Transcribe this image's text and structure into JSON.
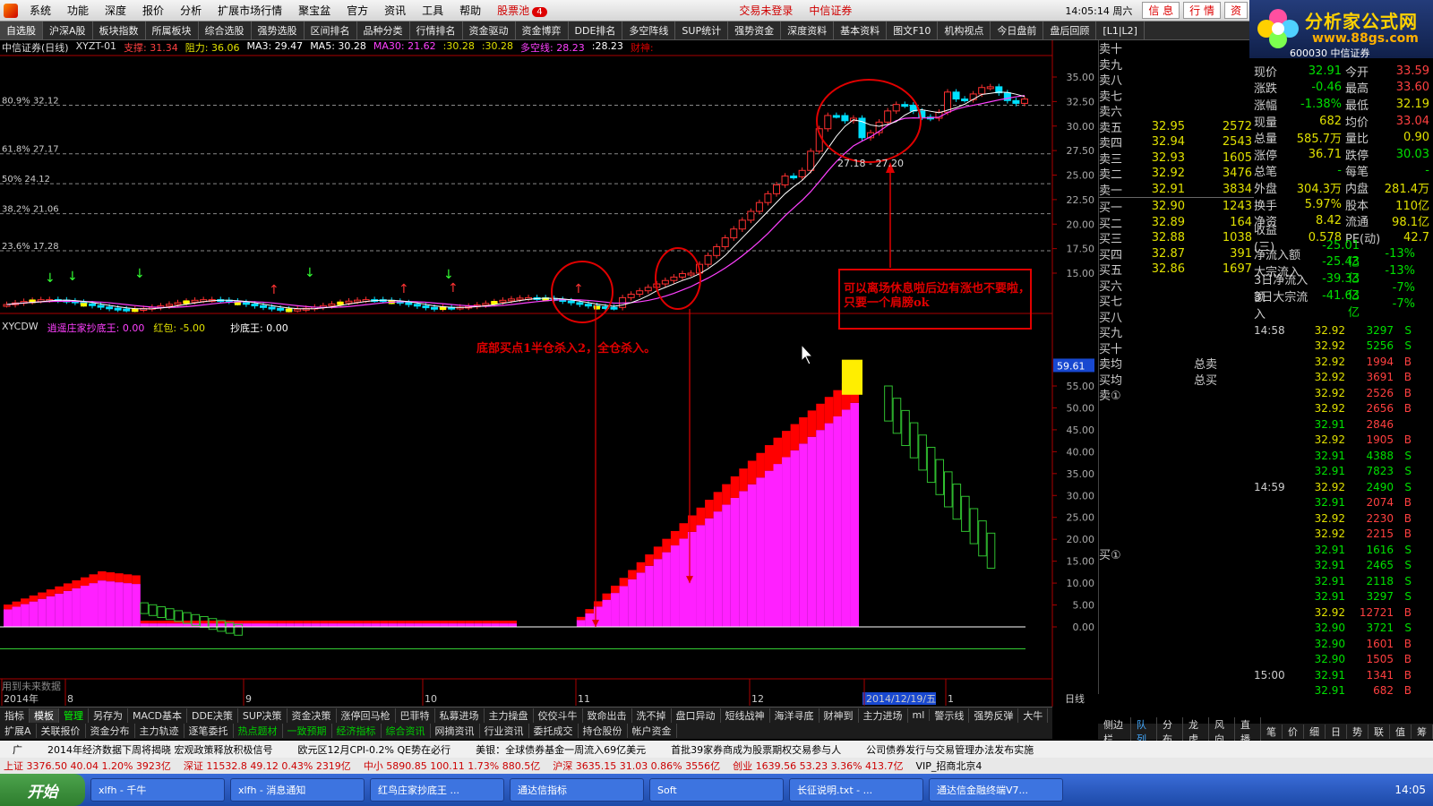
{
  "menu": {
    "items": [
      "系统",
      "功能",
      "深度",
      "报价",
      "分析",
      "扩展市场行情",
      "聚宝盆",
      "官方",
      "资讯",
      "工具",
      "帮助"
    ],
    "stock_pool": "股票池",
    "stock_pool_count": "4",
    "login_status": "交易未登录",
    "broker": "中信证券",
    "time": "14:05:14 周六",
    "right_btns": [
      "信 息",
      "行 情",
      "资"
    ]
  },
  "tabs": [
    "自选股",
    "沪深A股",
    "板块指数",
    "所属板块",
    "综合选股",
    "强势选股",
    "区间排名",
    "品种分类",
    "行情排名",
    "资金驱动",
    "资金博弈",
    "DDE排名",
    "多空阵线",
    "SUP统计",
    "强势资金",
    "深度资料",
    "基本资料",
    "图文F10",
    "机构视点",
    "今日盘前",
    "盘后回顾",
    "[L1|L2]"
  ],
  "logo": {
    "title": "分析家公式网",
    "url": "www.88gs.com",
    "code": "600030 中信证券"
  },
  "chart_info": {
    "name": "中信证券(日线)",
    "indicator": "XYZT-01",
    "support": "支撑: 31.34",
    "resist": "阻力: 36.06",
    "ma3": "MA3: 29.47",
    "ma5": "MA5: 30.28",
    "ma30": "MA30: 21.62",
    "v1": ":30.28",
    "v2": ":30.28",
    "duokong": "多空线: 28.23",
    "v3": ":28.23",
    "caishen": "财神:"
  },
  "fib_levels": [
    "80.9% 32.12",
    "61.8% 27.17",
    "50% 24.12",
    "38.2% 21.06",
    "23.6% 17.28"
  ],
  "price_axis": [
    "35.00",
    "32.50",
    "30.00",
    "27.50",
    "25.00",
    "22.50",
    "20.00",
    "17.50",
    "15.00"
  ],
  "indicator_line": {
    "name": "XYCDW",
    "title": "逍遥庄家抄底王: 0.00",
    "redpack": "红包: -5.00",
    "cdw": "抄底王: 0.00"
  },
  "ind_axis": [
    "55.00",
    "50.00",
    "45.00",
    "40.00",
    "35.00",
    "30.00",
    "25.00",
    "20.00",
    "15.00",
    "10.00",
    "5.00",
    "0.00"
  ],
  "ind_marker": "59.61",
  "annotations": {
    "buy": "底部买点1半仓杀入2，全仓杀入。",
    "exit": "可以离场休息啦后边有涨也不要啦，只要一个肩膀ok",
    "range": "27.18 - 27.20",
    "future": "用到未来数据"
  },
  "time_axis": [
    "2014年",
    "8",
    "9",
    "10",
    "11",
    "12",
    "2014/12/19/五",
    "1"
  ],
  "period": "日线",
  "orderbook": {
    "sell_labels": [
      "卖十",
      "卖九",
      "卖八",
      "卖七",
      "卖六",
      "卖五",
      "卖四",
      "卖三",
      "卖二",
      "卖一"
    ],
    "sell": [
      [
        "",
        ""
      ],
      [
        "",
        ""
      ],
      [
        "",
        ""
      ],
      [
        "",
        ""
      ],
      [
        "",
        ""
      ],
      [
        "32.95",
        "2572"
      ],
      [
        "32.94",
        "2543"
      ],
      [
        "32.93",
        "1605"
      ],
      [
        "32.92",
        "3476"
      ],
      [
        "32.91",
        "3834"
      ]
    ],
    "buy_labels": [
      "买一",
      "买二",
      "买三",
      "买四",
      "买五",
      "买六",
      "买七",
      "买八",
      "买九",
      "买十"
    ],
    "buy": [
      [
        "32.90",
        "1243"
      ],
      [
        "32.89",
        "164"
      ],
      [
        "32.88",
        "1038"
      ],
      [
        "32.87",
        "391"
      ],
      [
        "32.86",
        "1697"
      ],
      [
        "",
        ""
      ],
      [
        "",
        ""
      ],
      [
        "",
        ""
      ],
      [
        "",
        ""
      ],
      [
        "",
        ""
      ]
    ],
    "avg_sell": "卖均",
    "avg_buy": "买均",
    "total_sell": "总卖",
    "total_buy": "总买",
    "sell_circle": "卖①",
    "buy_circle": "买①"
  },
  "stats": [
    [
      "现价",
      "32.91",
      "今开",
      "33.59"
    ],
    [
      "涨跌",
      "-0.46",
      "最高",
      "33.60"
    ],
    [
      "涨幅",
      "-1.38%",
      "最低",
      "32.19"
    ],
    [
      "现量",
      "682",
      "均价",
      "33.04"
    ],
    [
      "总量",
      "585.7万",
      "量比",
      "0.90"
    ],
    [
      "涨停",
      "36.71",
      "跌停",
      "30.03"
    ],
    [
      "总笔",
      "-",
      "每笔",
      "-"
    ],
    [
      "外盘",
      "304.3万",
      "内盘",
      "281.4万"
    ],
    [
      "换手",
      "5.97%",
      "股本",
      "110亿"
    ],
    [
      "净资",
      "8.42",
      "流通",
      "98.1亿"
    ],
    [
      "收益(三)",
      "0.578",
      "PE(动)",
      "42.7"
    ],
    [
      "净流入额",
      "-25.01亿",
      "",
      "-13%"
    ],
    [
      "大宗流入",
      "-25.43亿",
      "",
      "-13%"
    ],
    [
      "3日净流入额",
      "-39.33亿",
      "",
      "-7%"
    ],
    [
      "3日大宗流入",
      "-41.63亿",
      "",
      "-7%"
    ]
  ],
  "ticks": [
    [
      "14:58",
      "32.92",
      "3297",
      "S"
    ],
    [
      "",
      "32.92",
      "5256",
      "S"
    ],
    [
      "",
      "32.92",
      "1994",
      "B"
    ],
    [
      "",
      "32.92",
      "3691",
      "B"
    ],
    [
      "",
      "32.92",
      "2526",
      "B"
    ],
    [
      "",
      "32.92",
      "2656",
      "B"
    ],
    [
      "",
      "32.91",
      "2846",
      ""
    ],
    [
      "",
      "32.92",
      "1905",
      "B"
    ],
    [
      "",
      "32.91",
      "4388",
      "S"
    ],
    [
      "",
      "32.91",
      "7823",
      "S"
    ],
    [
      "14:59",
      "32.92",
      "2490",
      "S"
    ],
    [
      "",
      "32.91",
      "2074",
      "B"
    ],
    [
      "",
      "32.92",
      "2230",
      "B"
    ],
    [
      "",
      "32.92",
      "2215",
      "B"
    ],
    [
      "",
      "32.91",
      "1616",
      "S"
    ],
    [
      "",
      "32.91",
      "2465",
      "S"
    ],
    [
      "",
      "32.91",
      "2118",
      "S"
    ],
    [
      "",
      "32.91",
      "3297",
      "S"
    ],
    [
      "",
      "32.92",
      "12721",
      "B"
    ],
    [
      "",
      "32.90",
      "3721",
      "S"
    ],
    [
      "",
      "32.90",
      "1601",
      "B"
    ],
    [
      "",
      "32.90",
      "1505",
      "B"
    ],
    [
      "15:00",
      "32.91",
      "1341",
      "B"
    ],
    [
      "",
      "32.91",
      "682",
      "B"
    ]
  ],
  "bottom_tabs": [
    "指标",
    "模板",
    "管理",
    "另存为",
    "MACD基本",
    "DDE决策",
    "SUP决策",
    "资金决策",
    "涨停回马枪",
    "巴菲特",
    "私募进场",
    "主力操盘",
    "佼佼斗牛",
    "致命出击",
    "洗不掉",
    "盘口异动",
    "短线战神",
    "海洋寻底",
    "财神到",
    "主力进场",
    "ml",
    "警示线",
    "强势反弹",
    "大牛"
  ],
  "bottom_tabs2": [
    "扩展A",
    "关联报价",
    "资金分布",
    "主力轨迹",
    "逐笔委托",
    "热点题材",
    "一致预期",
    "经济指标",
    "综合资讯",
    "网摘资讯",
    "行业资讯",
    "委托成交",
    "持仓股份",
    "帐户资金"
  ],
  "right_tabs": [
    "侧边栏",
    "队列",
    "分布",
    "龙虎",
    "风向",
    "直播",
    "笔",
    "价",
    "细",
    "日",
    "势",
    "联",
    "值",
    "筹"
  ],
  "news": [
    "广",
    "2014年经济数据下周将揭晓 宏观政策释放积极信号",
    "欧元区12月CPI-0.2% QE势在必行",
    "美银：全球债券基金一周流入69亿美元",
    "首批39家券商成为股票期权交易参与人",
    "公司债券发行与交易管理办法发布实施"
  ],
  "status": [
    "上证 3376.50 40.04 1.20% 3923亿",
    "深证 11532.8 49.12 0.43% 2319亿",
    "中小 5890.85 100.11 1.73% 880.5亿",
    "沪深 3635.15 31.03 0.86% 3556亿",
    "创业 1639.56 53.23 3.36% 413.7亿",
    "VIP_招商北京4"
  ],
  "taskbar": {
    "start": "开始",
    "tasks": [
      "xlfh - 千牛",
      "xlfh - 消息通知",
      "红鸟庄家抄底王 ...",
      "通达信指标",
      "Soft",
      "长征说明.txt - ...",
      "通达信金融终端V7..."
    ],
    "clock": "14:05"
  }
}
